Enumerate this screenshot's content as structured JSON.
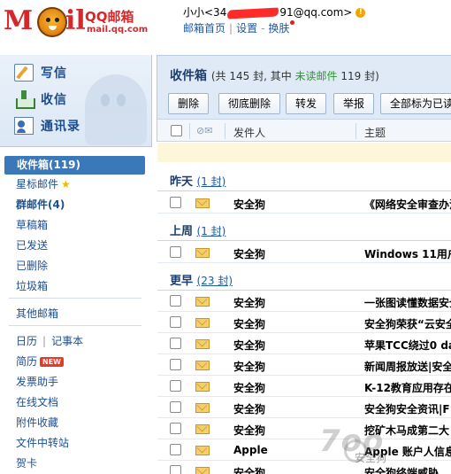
{
  "header": {
    "brand": "QQ邮箱",
    "domain": "mail.qq.com",
    "user_prefix": "小小<34",
    "user_suffix": "91@qq.com>",
    "vip_mark": "!",
    "links": [
      "邮箱首页",
      "设置",
      "换肤"
    ]
  },
  "sidebar": {
    "quick": [
      {
        "label": "写信",
        "icon": "compose-icon"
      },
      {
        "label": "收信",
        "icon": "receive-icon"
      },
      {
        "label": "通讯录",
        "icon": "contacts-icon"
      }
    ],
    "folders": {
      "inbox": "收件箱(119)",
      "starred": "星标邮件",
      "groups": "群邮件(4)",
      "drafts": "草稿箱",
      "sent": "已发送",
      "deleted": "已删除",
      "spam": "垃圾箱",
      "other": "其他邮箱",
      "calendar": "日历",
      "notes": "记事本",
      "resume": "简历",
      "resume_badge": "NEW",
      "invoice": "发票助手",
      "docs": "在线文档",
      "attachments": "附件收藏",
      "transfer": "文件中转站",
      "cards": "贺卡"
    }
  },
  "main": {
    "title": "收件箱",
    "subtitle_prefix": "(共 145 封, 其中 ",
    "subtitle_unread": "未读邮件",
    "subtitle_suffix": " 119 封)",
    "toolbar": [
      "删除",
      "彻底删除",
      "转发",
      "举报",
      "全部标为已读"
    ],
    "columns": {
      "sender": "发件人",
      "subject": "主题"
    },
    "groups": [
      {
        "title": "昨天",
        "count": "(1 封)"
      },
      {
        "title": "上周",
        "count": "(1 封)"
      },
      {
        "title": "更早",
        "count": "(23 封)"
      }
    ],
    "rows": [
      {
        "sender": "安全狗",
        "subject": "《网络安全审查办法》"
      },
      {
        "sender": "安全狗",
        "subject": "Windows 11用户"
      },
      {
        "sender": "安全狗",
        "subject": "一张图读懂数据安全"
      },
      {
        "sender": "安全狗",
        "subject": "安全狗荣获“云安全"
      },
      {
        "sender": "安全狗",
        "subject": "苹果TCC绕过0 day"
      },
      {
        "sender": "安全狗",
        "subject": "新闻周报放送|安全"
      },
      {
        "sender": "安全狗",
        "subject": "K-12教育应用存在"
      },
      {
        "sender": "安全狗",
        "subject": "安全狗安全资讯|F"
      },
      {
        "sender": "安全狗",
        "subject": "挖矿木马成第二大"
      },
      {
        "sender": "Apple",
        "subject": "Apple 账户人信息"
      },
      {
        "sender": "安全狗",
        "subject": "安全狗终端威胁"
      }
    ]
  },
  "watermark": {
    "big": "7oo",
    "small": "安全狗"
  }
}
